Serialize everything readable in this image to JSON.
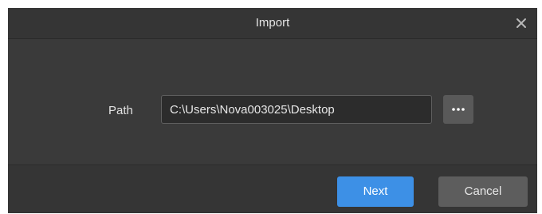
{
  "dialog": {
    "title": "Import",
    "close_icon": "close-icon"
  },
  "path": {
    "label": "Path",
    "value": "C:\\Users\\Nova003025\\Desktop",
    "browse_icon": "ellipsis-icon"
  },
  "footer": {
    "next_label": "Next",
    "cancel_label": "Cancel"
  },
  "colors": {
    "background": "#3a3a3a",
    "accent": "#3d90e6",
    "secondary_button": "#5d5d5d"
  }
}
